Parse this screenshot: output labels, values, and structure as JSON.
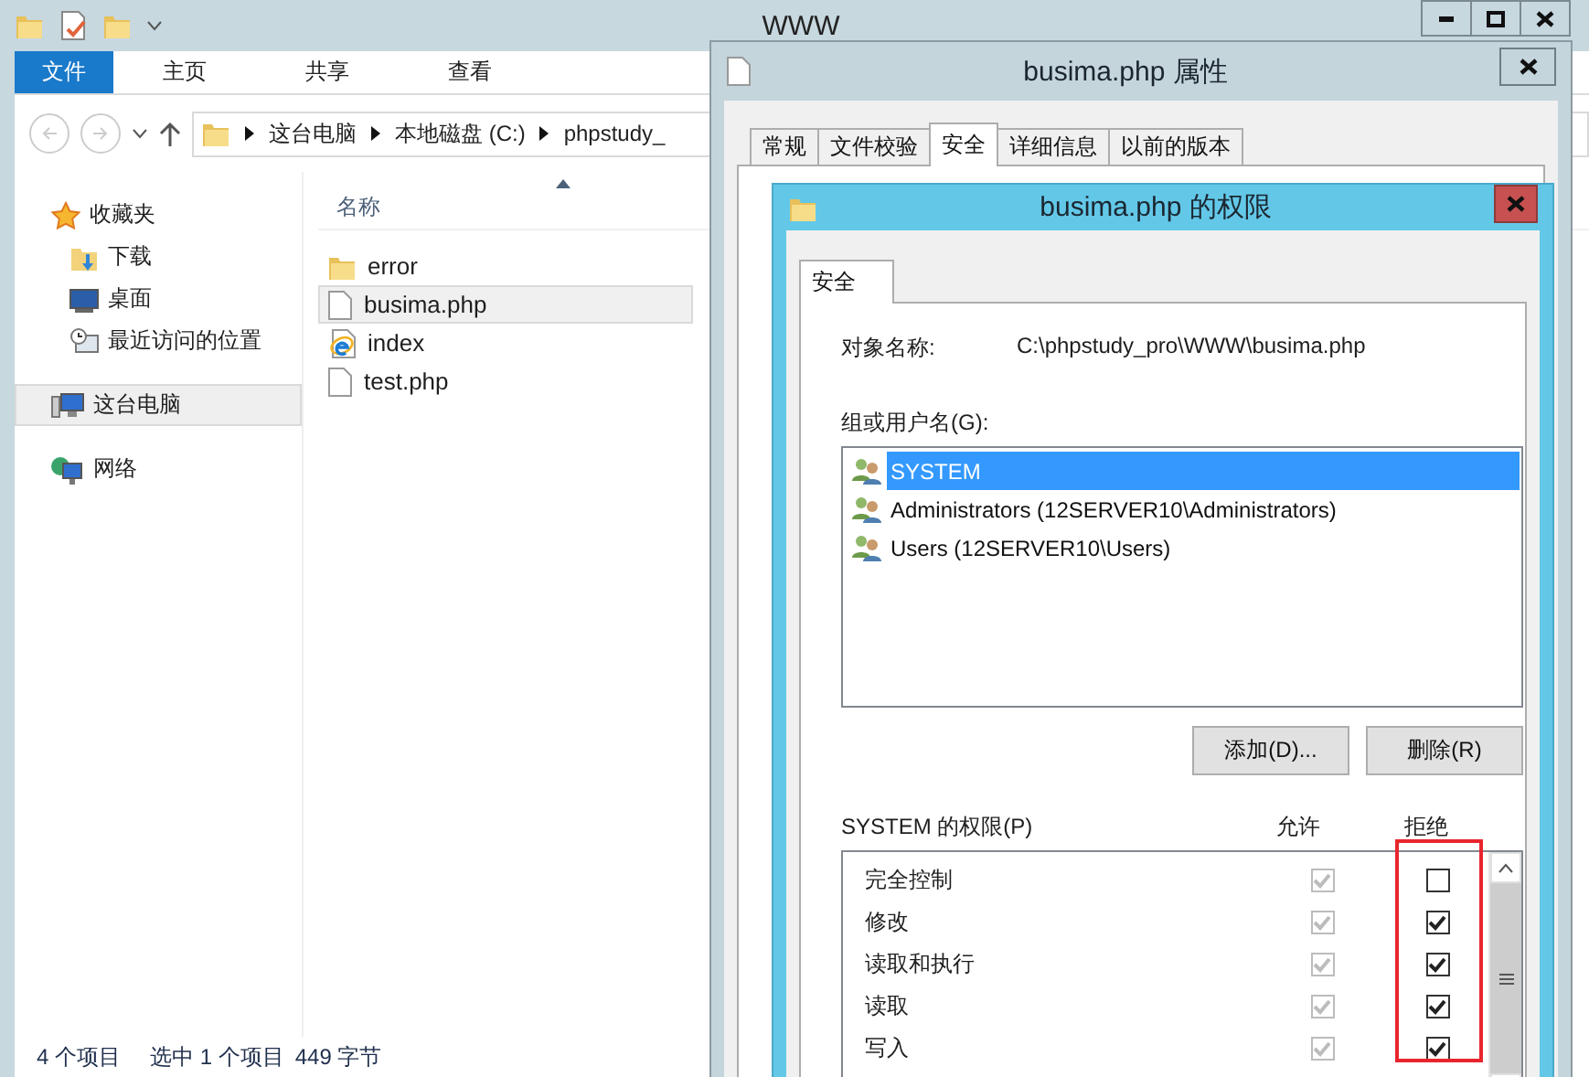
{
  "explorer": {
    "title": "WWW",
    "ribbon_tabs": [
      {
        "label": "文件",
        "selected": true
      },
      {
        "label": "主页",
        "selected": false
      },
      {
        "label": "共享",
        "selected": false
      },
      {
        "label": "查看",
        "selected": false
      }
    ],
    "breadcrumb": [
      "这台电脑",
      "本地磁盘 (C:)",
      "phpstudy_"
    ],
    "navigation": [
      {
        "label": "收藏夹",
        "kind": "favorites",
        "selected": false,
        "children": [
          {
            "label": "下载",
            "kind": "downloads",
            "selected": false
          },
          {
            "label": "桌面",
            "kind": "desktop",
            "selected": false
          },
          {
            "label": "最近访问的位置",
            "kind": "recent",
            "selected": false
          }
        ]
      },
      {
        "label": "这台电脑",
        "kind": "computer",
        "selected": true
      },
      {
        "label": "网络",
        "kind": "network",
        "selected": false
      }
    ],
    "column_header": "名称",
    "files": [
      {
        "name": "error",
        "kind": "folder",
        "selected": false
      },
      {
        "name": "busima.php",
        "kind": "file",
        "selected": true
      },
      {
        "name": "index",
        "kind": "web",
        "selected": false
      },
      {
        "name": "test.php",
        "kind": "file",
        "selected": false
      }
    ],
    "status": {
      "count": "4 个项目",
      "selection": "选中 1 个项目",
      "size": "449 字节"
    }
  },
  "properties": {
    "title": "busima.php 属性",
    "tabs": [
      {
        "label": "常规",
        "selected": false
      },
      {
        "label": "文件校验",
        "selected": false
      },
      {
        "label": "安全",
        "selected": true
      },
      {
        "label": "详细信息",
        "selected": false
      },
      {
        "label": "以前的版本",
        "selected": false
      }
    ]
  },
  "permissions": {
    "title": "busima.php 的权限",
    "tabs": [
      {
        "label": "安全",
        "selected": true
      }
    ],
    "object_label": "对象名称:",
    "object_path": "C:\\phpstudy_pro\\WWW\\busima.php",
    "groups_label": "组或用户名(G):",
    "principals": [
      {
        "name": "SYSTEM",
        "selected": true
      },
      {
        "name": "Administrators (12SERVER10\\Administrators)",
        "selected": false
      },
      {
        "name": "Users (12SERVER10\\Users)",
        "selected": false
      }
    ],
    "buttons": [
      "添加(D)...",
      "删除(R)"
    ],
    "perm_label": "SYSTEM 的权限(P)",
    "allow_header": "允许",
    "deny_header": "拒绝",
    "rows": [
      {
        "name": "完全控制",
        "allow": true,
        "allow_disabled": true,
        "deny": false
      },
      {
        "name": "修改",
        "allow": true,
        "allow_disabled": true,
        "deny": true
      },
      {
        "name": "读取和执行",
        "allow": true,
        "allow_disabled": true,
        "deny": true
      },
      {
        "name": "读取",
        "allow": true,
        "allow_disabled": true,
        "deny": true
      },
      {
        "name": "写入",
        "allow": true,
        "allow_disabled": true,
        "deny": true
      }
    ]
  }
}
